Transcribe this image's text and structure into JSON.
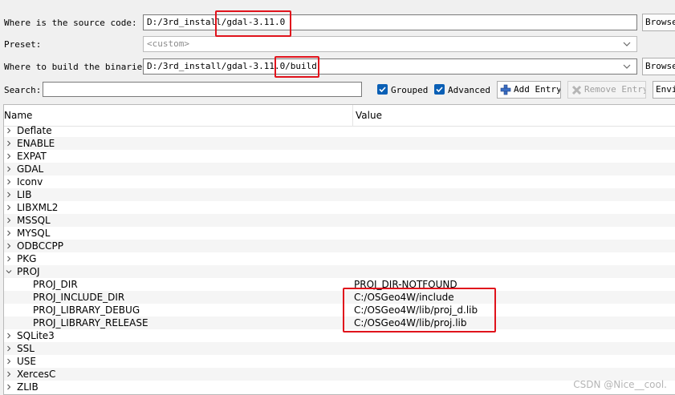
{
  "top_cutoff_text": "— — — — —",
  "source": {
    "label": "Where is the source code:",
    "value": "D:/3rd_install/gdal-3.11.0",
    "browse": "Browse"
  },
  "preset": {
    "label": "Preset:",
    "value": "<custom>"
  },
  "build": {
    "label": "Where to build the binaries:",
    "value": "D:/3rd_install/gdal-3.11.0/build",
    "browse": "Browse"
  },
  "search": {
    "label": "Search:",
    "value": ""
  },
  "options": {
    "grouped": "Grouped",
    "advanced": "Advanced"
  },
  "buttons": {
    "add_entry": "Add Entry",
    "remove_entry": "Remove Entry",
    "environment": "Envir"
  },
  "table": {
    "col_name": "Name",
    "col_value": "Value",
    "rows": [
      {
        "name": "Deflate",
        "value": ""
      },
      {
        "name": "ENABLE",
        "value": ""
      },
      {
        "name": "EXPAT",
        "value": ""
      },
      {
        "name": "GDAL",
        "value": ""
      },
      {
        "name": "Iconv",
        "value": ""
      },
      {
        "name": "LIB",
        "value": ""
      },
      {
        "name": "LIBXML2",
        "value": ""
      },
      {
        "name": "MSSQL",
        "value": ""
      },
      {
        "name": "MYSQL",
        "value": ""
      },
      {
        "name": "ODBCCPP",
        "value": ""
      },
      {
        "name": "PKG",
        "value": ""
      },
      {
        "name": "PROJ",
        "value": ""
      },
      {
        "name": "PROJ_DIR",
        "value": "PROJ_DIR-NOTFOUND"
      },
      {
        "name": "PROJ_INCLUDE_DIR",
        "value": "C:/OSGeo4W/include"
      },
      {
        "name": "PROJ_LIBRARY_DEBUG",
        "value": "C:/OSGeo4W/lib/proj_d.lib"
      },
      {
        "name": "PROJ_LIBRARY_RELEASE",
        "value": "C:/OSGeo4W/lib/proj.lib"
      },
      {
        "name": "SQLite3",
        "value": ""
      },
      {
        "name": "SSL",
        "value": ""
      },
      {
        "name": "USE",
        "value": ""
      },
      {
        "name": "XercesC",
        "value": ""
      },
      {
        "name": "ZLIB",
        "value": ""
      }
    ]
  },
  "watermark": "CSDN @Nice__cool.",
  "colors": {
    "highlight": "#e0131c",
    "checkbox": "#0a5fb5"
  }
}
